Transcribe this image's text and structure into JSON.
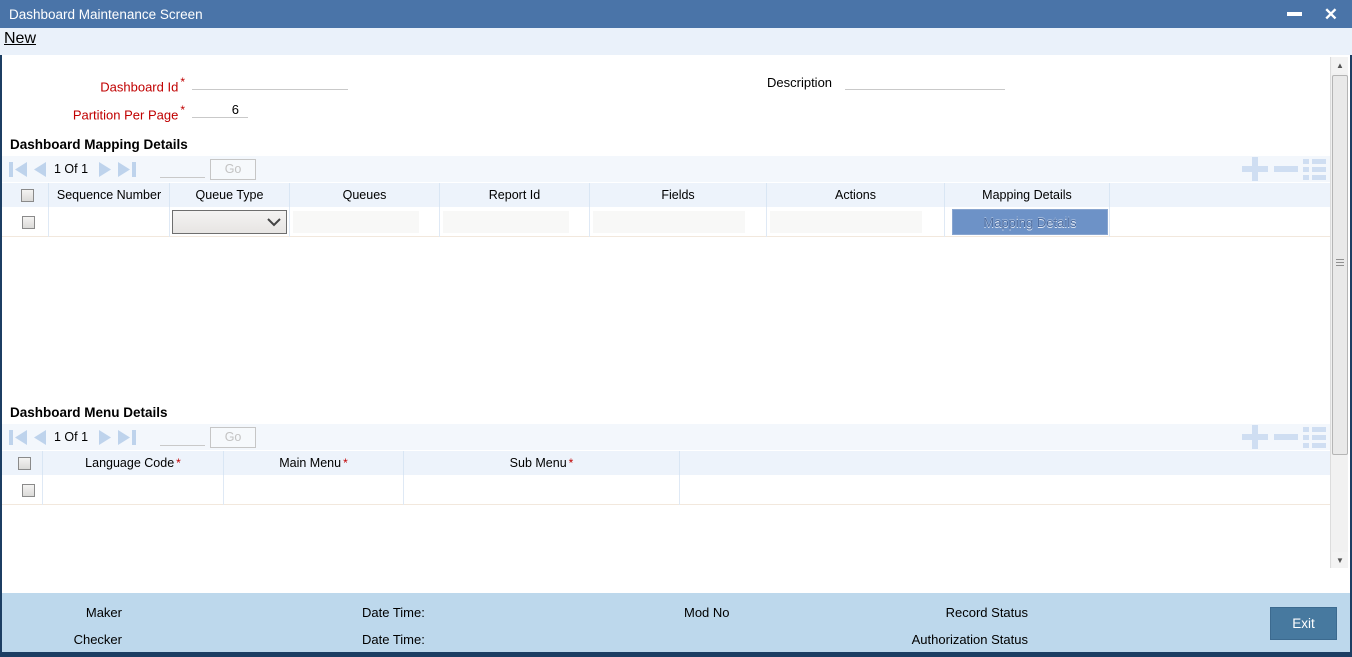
{
  "titlebar": {
    "title": "Dashboard Maintenance Screen",
    "close_glyph": "✕"
  },
  "menubar": {
    "new_label": "New"
  },
  "form": {
    "dashboard_id_label": "Dashboard Id",
    "dashboard_id_required": "*",
    "dashboard_id_value": "",
    "description_label": "Description",
    "description_value": "",
    "partition_label": "Partition Per Page",
    "partition_required": "*",
    "partition_value": "6"
  },
  "mapping_section": {
    "title": "Dashboard Mapping Details",
    "pagination": {
      "page_text": "1 Of 1",
      "page_input_value": "",
      "go_label": "Go"
    },
    "columns": [
      "Sequence Number",
      "Queue Type",
      "Queues",
      "Report Id",
      "Fields",
      "Actions",
      "Mapping Details"
    ],
    "row": {
      "sequence_number": "",
      "queue_type_selected": "",
      "queues": "",
      "report_id": "",
      "fields": "",
      "actions": "",
      "mapping_details_button_label": "Mapping Details"
    }
  },
  "menu_section": {
    "title": "Dashboard Menu Details",
    "pagination": {
      "page_text": "1 Of 1",
      "page_input_value": "",
      "go_label": "Go"
    },
    "columns": [
      {
        "label": "Language Code",
        "required": "*"
      },
      {
        "label": "Main Menu",
        "required": "*"
      },
      {
        "label": "Sub Menu",
        "required": "*"
      }
    ],
    "row": {
      "language_code": "",
      "main_menu": "",
      "sub_menu": ""
    }
  },
  "scrollbar": {
    "up_glyph": "▲",
    "down_glyph": "▼"
  },
  "footer": {
    "maker_label": "Maker",
    "maker_datetime_label": "Date Time:",
    "checker_label": "Checker",
    "checker_datetime_label": "Date Time:",
    "mod_no_label": "Mod No",
    "record_status_label": "Record Status",
    "authorization_status_label": "Authorization Status",
    "exit_label": "Exit"
  },
  "colors": {
    "titlebar": "#4a74a8",
    "toolbar_bg": "#eaf1fa",
    "table_header_bg": "#edf3fb",
    "accent_button": "#6d92c7",
    "footer_bg": "#bdd8ec",
    "exit_button": "#47799f",
    "required_label": "#c00000",
    "window_edge": "#1c3e63"
  }
}
